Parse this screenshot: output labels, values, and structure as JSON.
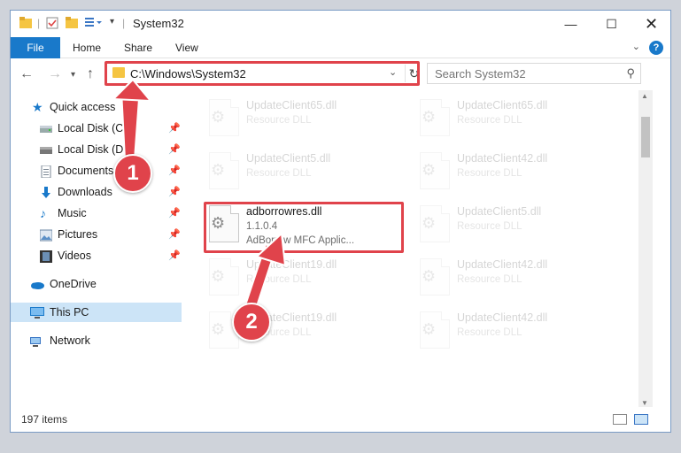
{
  "window": {
    "title": "System32"
  },
  "ribbon": {
    "tabs": [
      "File",
      "Home",
      "Share",
      "View"
    ],
    "help": "?"
  },
  "address": {
    "path": "C:\\Windows\\System32"
  },
  "search": {
    "placeholder": "Search System32"
  },
  "sidebar": {
    "items": [
      {
        "label": "Quick access",
        "icon": "star-icon"
      },
      {
        "label": "Local Disk (C:)",
        "icon": "drive-icon",
        "pinned": true
      },
      {
        "label": "Local Disk (D:)",
        "icon": "drive-icon",
        "pinned": true
      },
      {
        "label": "Documents",
        "icon": "documents-icon",
        "pinned": true
      },
      {
        "label": "Downloads",
        "icon": "downloads-icon",
        "pinned": true
      },
      {
        "label": "Music",
        "icon": "music-icon",
        "pinned": true
      },
      {
        "label": "Pictures",
        "icon": "pictures-icon",
        "pinned": true
      },
      {
        "label": "Videos",
        "icon": "videos-icon",
        "pinned": true
      },
      {
        "label": "OneDrive",
        "icon": "onedrive-icon"
      },
      {
        "label": "This PC",
        "icon": "pc-icon",
        "selected": true
      },
      {
        "label": "Network",
        "icon": "network-icon"
      }
    ]
  },
  "files": {
    "left": [
      {
        "name": "UpdateClient65.dll",
        "type": "Resource DLL"
      },
      {
        "name": "UpdateClient5.dll",
        "type": "Resource DLL"
      },
      {
        "name": "adborrowres.dll",
        "version": "1.1.0.4",
        "type": "AdBorrow MFC Applic..."
      },
      {
        "name": "UpdateClient19.dll",
        "type": "Resource DLL"
      },
      {
        "name": "UpdateClient19.dll",
        "type": "Resource DLL"
      }
    ],
    "right": [
      {
        "name": "UpdateClient65.dll",
        "type": "Resource DLL"
      },
      {
        "name": "UpdateClient42.dll",
        "type": "Resource DLL"
      },
      {
        "name": "UpdateClient5.dll",
        "type": "Resource DLL"
      },
      {
        "name": "UpdateClient42.dll",
        "type": "Resource DLL"
      },
      {
        "name": "UpdateClient42.dll",
        "type": "Resource DLL"
      }
    ]
  },
  "status": {
    "count": "197 items"
  },
  "annotations": {
    "step1": "1",
    "step2": "2"
  },
  "colors": {
    "accent": "#1979ca",
    "highlight": "#e0434b",
    "selected": "#cce4f7"
  }
}
